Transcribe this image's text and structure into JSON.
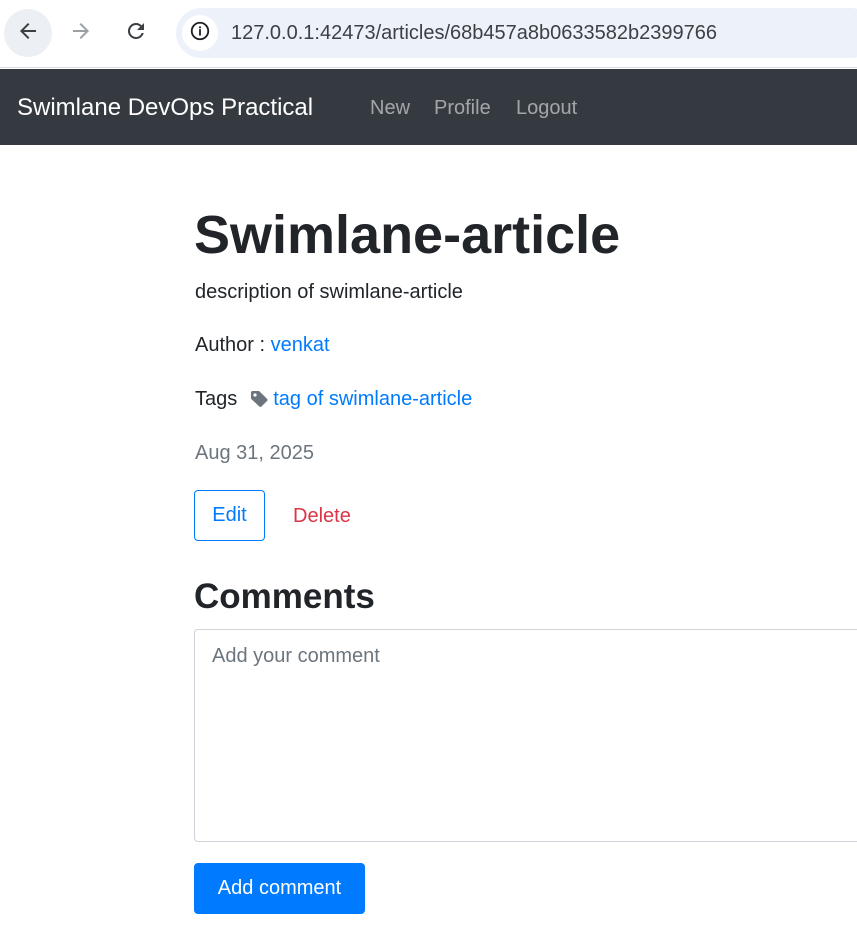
{
  "browser": {
    "url": "127.0.0.1:42473/articles/68b457a8b0633582b2399766"
  },
  "navbar": {
    "brand": "Swimlane DevOps Practical",
    "links": {
      "new": "New",
      "profile": "Profile",
      "logout": "Logout"
    }
  },
  "article": {
    "title": "Swimlane-article",
    "description": "description of swimlane-article",
    "author_label": "Author : ",
    "author_name": "venkat",
    "tags_label": "Tags",
    "tag": "tag of swimlane-article",
    "date": "Aug 31, 2025",
    "edit_label": "Edit",
    "delete_label": "Delete"
  },
  "comments": {
    "heading": "Comments",
    "placeholder": "Add your comment",
    "value": "",
    "submit_label": "Add comment"
  },
  "colors": {
    "navbar_bg": "#343a40",
    "primary": "#007bff",
    "danger": "#dc3545",
    "muted": "#6c757d"
  },
  "icons": {
    "back": "arrow-left-icon",
    "forward": "arrow-right-icon",
    "reload": "reload-icon",
    "site_info": "info-icon",
    "tag": "tag-icon"
  }
}
